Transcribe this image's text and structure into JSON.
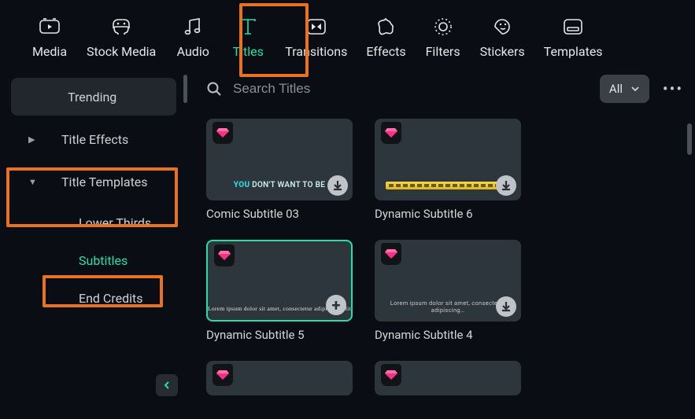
{
  "topbar": {
    "items": [
      {
        "label": "Media"
      },
      {
        "label": "Stock Media"
      },
      {
        "label": "Audio"
      },
      {
        "label": "Titles"
      },
      {
        "label": "Transitions"
      },
      {
        "label": "Effects"
      },
      {
        "label": "Filters"
      },
      {
        "label": "Stickers"
      },
      {
        "label": "Templates"
      }
    ]
  },
  "sidebar": {
    "items": [
      {
        "label": "Trending"
      },
      {
        "label": "Title Effects"
      },
      {
        "label": "Title Templates"
      },
      {
        "label": "Lower Thirds"
      },
      {
        "label": "Subtitles"
      },
      {
        "label": "End Credits"
      }
    ]
  },
  "search": {
    "placeholder": "Search Titles"
  },
  "filter": {
    "label": "All"
  },
  "cards": [
    {
      "title": "Comic Subtitle 03",
      "preview_bold": "YOU",
      "preview_rest": " DON'T WANT TO BE"
    },
    {
      "title": "Dynamic Subtitle 6"
    },
    {
      "title": "Dynamic Subtitle 5",
      "preview": "Lorem ipsum dolor sit amet, consectetur adipiscing elit"
    },
    {
      "title": "Dynamic Subtitle 4",
      "preview": "Lorem ipsum dolor sit amet, consectetur adipiscing…"
    }
  ]
}
